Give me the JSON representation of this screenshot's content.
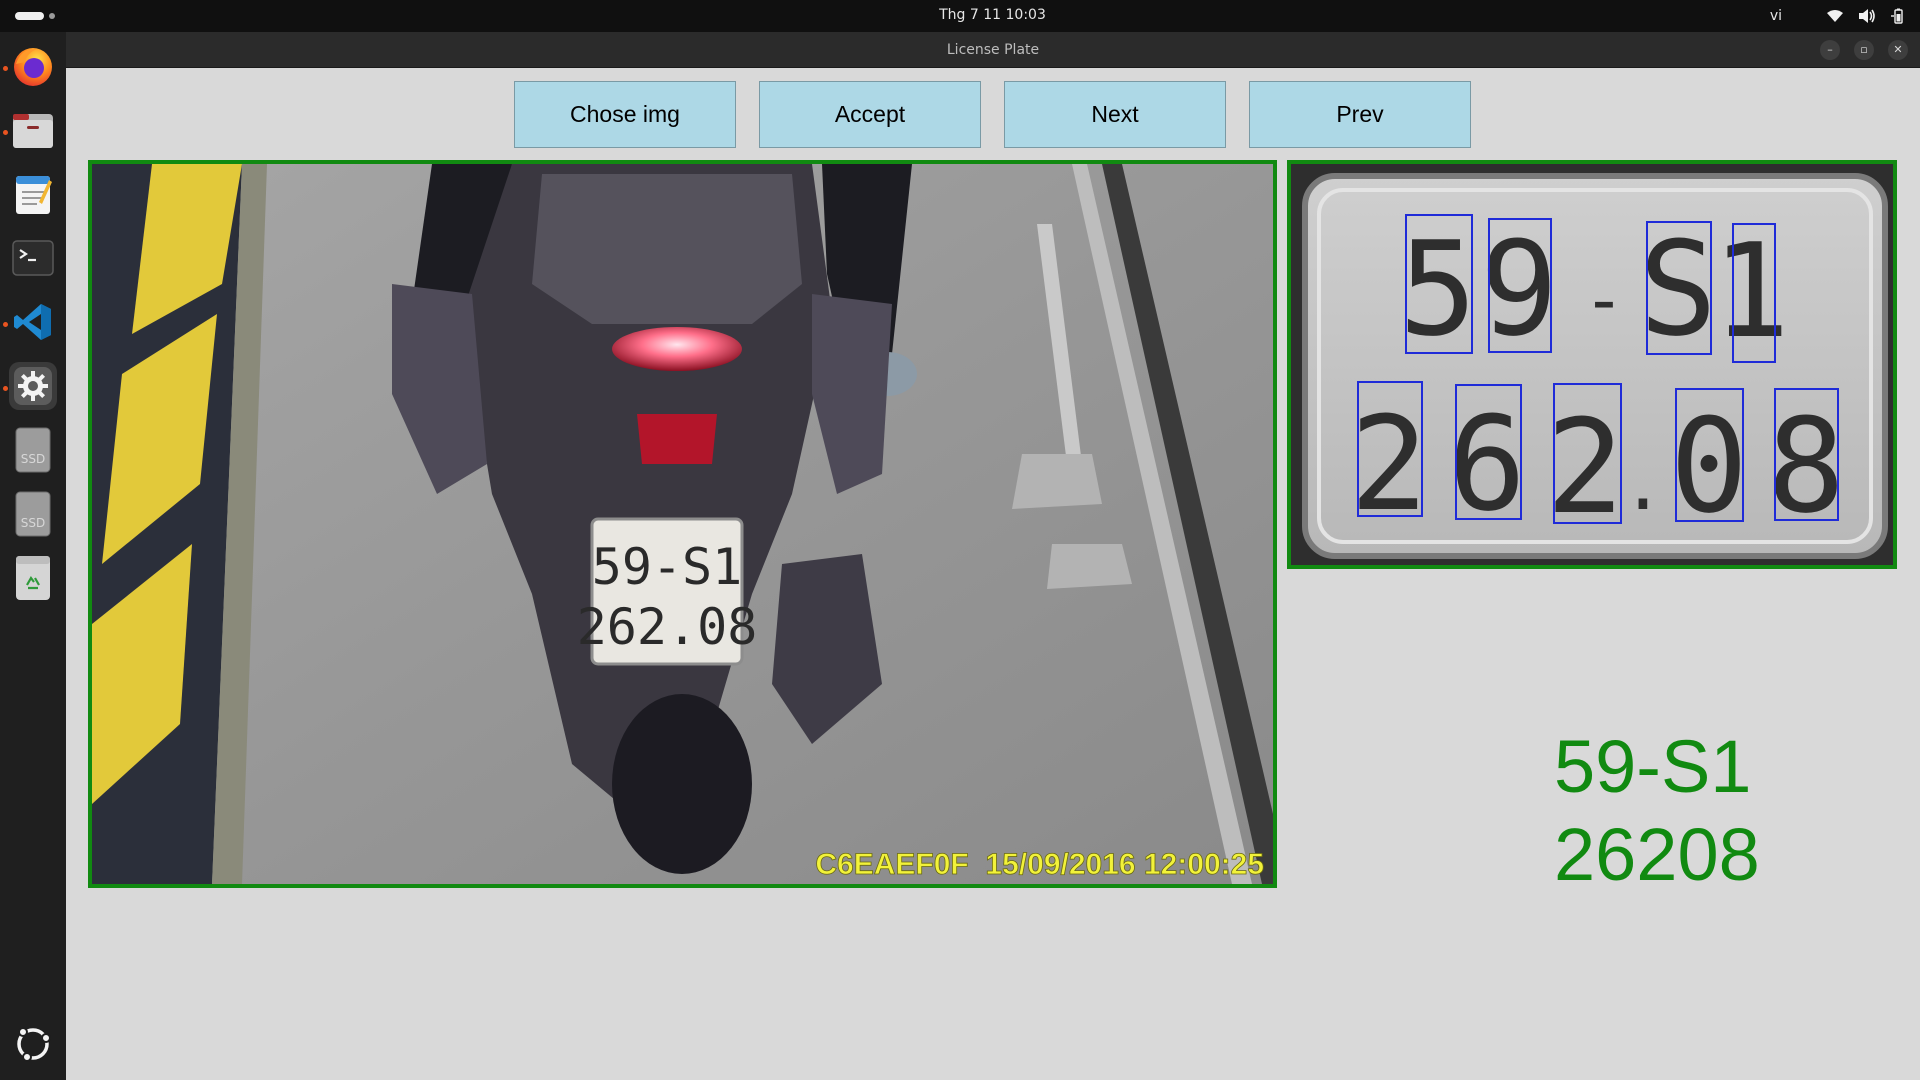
{
  "topbar": {
    "datetime": "Thg 7 11  10:03",
    "keyboard_layout": "vi"
  },
  "dock": {
    "items": [
      {
        "name": "firefox",
        "running": true
      },
      {
        "name": "files",
        "running": true
      },
      {
        "name": "text-editor",
        "running": false
      },
      {
        "name": "terminal",
        "running": false
      },
      {
        "name": "vscode",
        "running": true
      },
      {
        "name": "settings",
        "running": true,
        "active": true
      },
      {
        "name": "ssd-drive-1",
        "label": "SSD"
      },
      {
        "name": "ssd-drive-2",
        "label": "SSD"
      },
      {
        "name": "trash"
      }
    ]
  },
  "window": {
    "title": "License Plate"
  },
  "toolbar": {
    "chose_img": "Chose img",
    "accept": "Accept",
    "next": "Next",
    "prev": "Prev"
  },
  "camera": {
    "overlay": "C6EAEF0F  15/09/2016 12:00:25",
    "plate_line1": "59-S1",
    "plate_line2": "262.08"
  },
  "plate_crop": {
    "line1_chars": [
      "5",
      "9",
      "-",
      "S",
      "1"
    ],
    "line2_chars": [
      "2",
      "6",
      "2",
      ".",
      "0",
      "8"
    ]
  },
  "result": {
    "line1": "59-S1",
    "line2": "26208"
  },
  "colors": {
    "button_bg": "#add8e6",
    "frame_border": "#118a11",
    "result_text": "#118a11",
    "detection_box": "#1f2bd8"
  }
}
